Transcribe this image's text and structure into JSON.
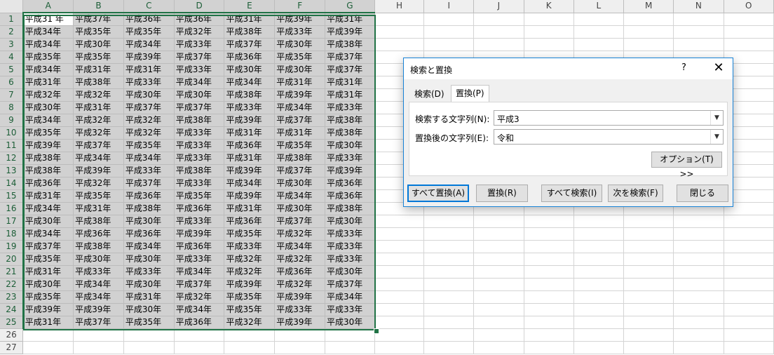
{
  "columns": [
    "A",
    "B",
    "C",
    "D",
    "E",
    "F",
    "G",
    "H",
    "I",
    "J",
    "K",
    "L",
    "M",
    "N",
    "O"
  ],
  "row_numbers": [
    "1",
    "2",
    "3",
    "4",
    "5",
    "6",
    "7",
    "8",
    "9",
    "10",
    "11",
    "12",
    "13",
    "14",
    "15",
    "16",
    "17",
    "18",
    "19",
    "20",
    "21",
    "22",
    "23",
    "24",
    "25",
    "26",
    "27"
  ],
  "cells": [
    [
      "平成31 年",
      "平成37年",
      "平成36年",
      "平成36年",
      "平成31年",
      "平成39年",
      "平成31年"
    ],
    [
      "平成34年",
      "平成35年",
      "平成35年",
      "平成32年",
      "平成38年",
      "平成33年",
      "平成39年"
    ],
    [
      "平成34年",
      "平成30年",
      "平成34年",
      "平成33年",
      "平成37年",
      "平成30年",
      "平成38年"
    ],
    [
      "平成35年",
      "平成35年",
      "平成39年",
      "平成37年",
      "平成36年",
      "平成35年",
      "平成37年"
    ],
    [
      "平成34年",
      "平成31年",
      "平成31年",
      "平成33年",
      "平成30年",
      "平成30年",
      "平成37年"
    ],
    [
      "平成31年",
      "平成38年",
      "平成33年",
      "平成34年",
      "平成34年",
      "平成31年",
      "平成31年"
    ],
    [
      "平成32年",
      "平成32年",
      "平成30年",
      "平成30年",
      "平成38年",
      "平成39年",
      "平成31年"
    ],
    [
      "平成30年",
      "平成31年",
      "平成37年",
      "平成37年",
      "平成33年",
      "平成34年",
      "平成33年"
    ],
    [
      "平成34年",
      "平成32年",
      "平成32年",
      "平成38年",
      "平成39年",
      "平成37年",
      "平成38年"
    ],
    [
      "平成35年",
      "平成32年",
      "平成32年",
      "平成33年",
      "平成31年",
      "平成31年",
      "平成38年"
    ],
    [
      "平成39年",
      "平成37年",
      "平成35年",
      "平成33年",
      "平成36年",
      "平成35年",
      "平成30年"
    ],
    [
      "平成38年",
      "平成34年",
      "平成34年",
      "平成33年",
      "平成31年",
      "平成38年",
      "平成33年"
    ],
    [
      "平成38年",
      "平成39年",
      "平成33年",
      "平成38年",
      "平成39年",
      "平成37年",
      "平成39年"
    ],
    [
      "平成36年",
      "平成32年",
      "平成37年",
      "平成33年",
      "平成34年",
      "平成30年",
      "平成36年"
    ],
    [
      "平成31年",
      "平成35年",
      "平成36年",
      "平成35年",
      "平成39年",
      "平成34年",
      "平成36年"
    ],
    [
      "平成34年",
      "平成31年",
      "平成38年",
      "平成36年",
      "平成31年",
      "平成30年",
      "平成38年"
    ],
    [
      "平成30年",
      "平成38年",
      "平成30年",
      "平成33年",
      "平成36年",
      "平成37年",
      "平成30年"
    ],
    [
      "平成34年",
      "平成36年",
      "平成36年",
      "平成39年",
      "平成35年",
      "平成32年",
      "平成33年"
    ],
    [
      "平成37年",
      "平成38年",
      "平成34年",
      "平成36年",
      "平成33年",
      "平成34年",
      "平成33年"
    ],
    [
      "平成35年",
      "平成30年",
      "平成30年",
      "平成33年",
      "平成32年",
      "平成32年",
      "平成33年"
    ],
    [
      "平成31年",
      "平成33年",
      "平成33年",
      "平成34年",
      "平成32年",
      "平成36年",
      "平成30年"
    ],
    [
      "平成30年",
      "平成34年",
      "平成30年",
      "平成37年",
      "平成39年",
      "平成32年",
      "平成37年"
    ],
    [
      "平成35年",
      "平成34年",
      "平成31年",
      "平成32年",
      "平成35年",
      "平成39年",
      "平成34年"
    ],
    [
      "平成39年",
      "平成39年",
      "平成30年",
      "平成34年",
      "平成35年",
      "平成33年",
      "平成33年"
    ],
    [
      "平成31年",
      "平成37年",
      "平成35年",
      "平成36年",
      "平成32年",
      "平成39年",
      "平成30年"
    ]
  ],
  "dialog": {
    "title": "検索と置換",
    "help": "?",
    "close": "✕",
    "tabs": {
      "search": "検索(D)",
      "replace": "置換(P)"
    },
    "find_label": "検索する文字列(N):",
    "find_value": "平成3",
    "replace_label": "置換後の文字列(E):",
    "replace_value": "令和",
    "options_button": "オプション(T) >>",
    "buttons": {
      "replace_all": "すべて置換(A)",
      "replace": "置換(R)",
      "find_all": "すべて検索(I)",
      "find_next": "次を検索(F)",
      "close": "閉じる"
    }
  },
  "colors": {
    "selection_border": "#217346",
    "dialog_border": "#1883d7",
    "selected_fill": "#d1d1d1"
  }
}
